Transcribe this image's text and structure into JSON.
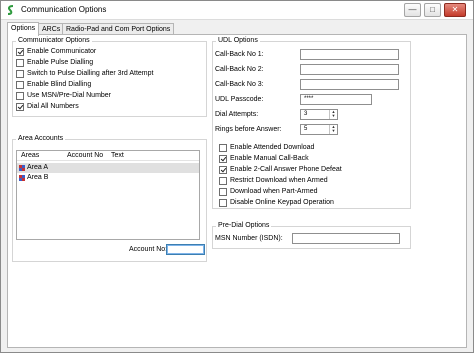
{
  "window": {
    "title": "Communication Options",
    "minimize_glyph": "—",
    "maximize_glyph": "□",
    "close_glyph": "✕"
  },
  "tabs": [
    "Options",
    "ARCs",
    "Radio-Pad and Com Port Options"
  ],
  "communicator_options": {
    "legend": "Communicator Options",
    "items": [
      {
        "label": "Enable Communicator",
        "checked": true
      },
      {
        "label": "Enable Pulse Dialling",
        "checked": false
      },
      {
        "label": "Switch to Pulse Dialling after 3rd Attempt",
        "checked": false
      },
      {
        "label": "Enable Blind Dialling",
        "checked": false
      },
      {
        "label": "Use MSN/Pre-Dial Number",
        "checked": false
      },
      {
        "label": "Dial All Numbers",
        "checked": true
      }
    ]
  },
  "area_accounts": {
    "legend": "Area Accounts",
    "columns": [
      "Areas",
      "Account No",
      "Text"
    ],
    "rows": [
      {
        "area": "Area A",
        "account": "",
        "text": ""
      },
      {
        "area": "Area B",
        "account": "",
        "text": ""
      }
    ],
    "account_no_label": "Account No:",
    "account_no_value": ""
  },
  "udl_options": {
    "legend": "UDL Options",
    "callback_1_label": "Call-Back No 1:",
    "callback_1_value": "",
    "callback_2_label": "Call-Back No 2:",
    "callback_2_value": "",
    "callback_3_label": "Call-Back No 3:",
    "callback_3_value": "",
    "passcode_label": "UDL Passcode:",
    "passcode_value": "****",
    "dial_attempts_label": "Dial Attempts:",
    "dial_attempts_value": "3",
    "rings_label": "Rings before Answer:",
    "rings_value": "5",
    "checks": [
      {
        "label": "Enable Attended Download",
        "checked": false
      },
      {
        "label": "Enable Manual Call-Back",
        "checked": true
      },
      {
        "label": "Enable 2-Call Answer Phone Defeat",
        "checked": true
      },
      {
        "label": "Restrict Download when Armed",
        "checked": false
      },
      {
        "label": "Download when Part-Armed",
        "checked": false
      },
      {
        "label": "Disable Online Keypad Operation",
        "checked": false
      }
    ]
  },
  "pre_dial": {
    "legend": "Pre-Dial Options",
    "msn_label": "MSN Number (ISDN):",
    "msn_value": ""
  },
  "colors": {
    "close_button": "#c43b2b",
    "focus_border": "#3c7fb1",
    "selected_row": "#e0e0e0"
  },
  "icons": {
    "app": "green-s-logo-icon",
    "area": "area-grid-icon"
  }
}
